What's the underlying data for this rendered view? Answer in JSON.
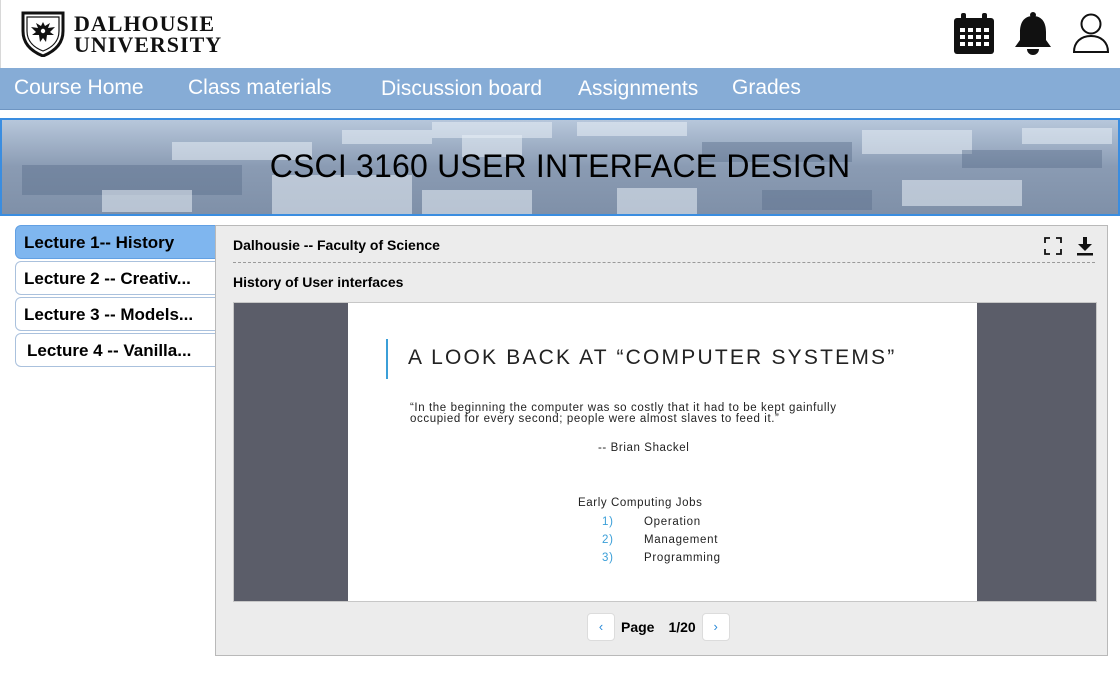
{
  "header": {
    "logo_line1": "DALHOUSIE",
    "logo_line2": "UNIVERSITY",
    "icons": [
      "calendar-icon",
      "bell-icon",
      "user-icon"
    ]
  },
  "nav": {
    "items": [
      "Course Home",
      "Class materials",
      "Discussion board",
      "Assignments",
      "Grades"
    ]
  },
  "banner": {
    "title": "CSCI 3160 USER INTERFACE DESIGN"
  },
  "lectures": {
    "items": [
      "Lecture 1-- History",
      "Lecture 2 -- Creativ...",
      "Lecture 3 -- Models...",
      "Lecture 4 -- Vanilla..."
    ],
    "active_index": 0
  },
  "viewer": {
    "title": "Dalhousie -- Faculty of Science",
    "subtitle": "History of User interfaces",
    "tools": [
      "fullscreen-icon",
      "download-icon"
    ],
    "slide": {
      "heading": "A LOOK BACK AT “COMPUTER SYSTEMS”",
      "quote": "“In the beginning the computer was so costly that it had to be kept gainfully occupied for every second; people were almost slaves to feed it.”",
      "author": "-- Brian Shackel",
      "jobs_heading": "Early Computing Jobs",
      "jobs": [
        {
          "num": "1)",
          "label": "Operation"
        },
        {
          "num": "2)",
          "label": "Management"
        },
        {
          "num": "3)",
          "label": "Programming"
        }
      ]
    },
    "pager": {
      "prev": "‹",
      "label": "Page",
      "count": "1/20",
      "next": "›"
    }
  },
  "colors": {
    "nav_bg": "#86acd6",
    "tab_active": "#7fb6ef",
    "banner_border": "#3a8de0",
    "accent_blue": "#3b9fd8"
  }
}
